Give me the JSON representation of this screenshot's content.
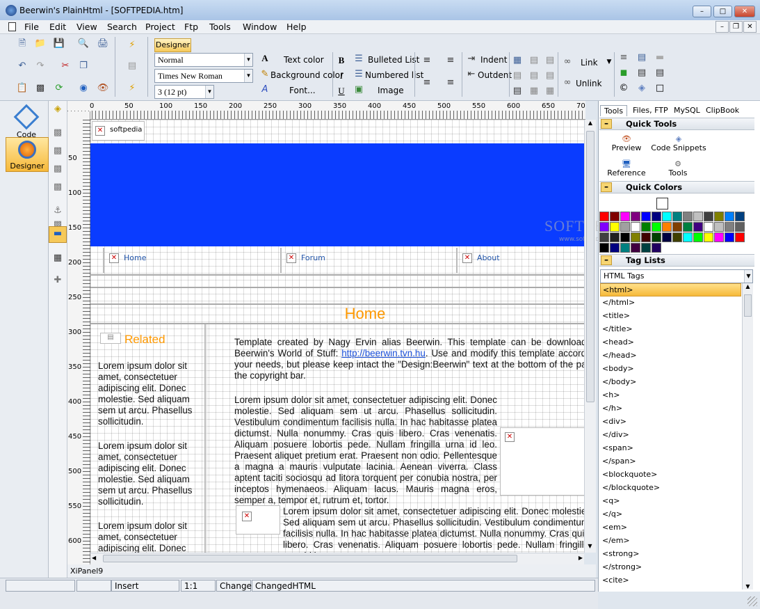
{
  "window": {
    "title": "Beerwin's PlainHtml - [SOFTPEDIA.htm]"
  },
  "menu": [
    "File",
    "Edit",
    "View",
    "Search",
    "Project",
    "Ftp",
    "Tools",
    "Window",
    "Help"
  ],
  "toolbar": {
    "designer_tab": "Designer",
    "paragraph_style": "Normal",
    "font_name": "Times New Roman",
    "font_size": "3  (12 pt)",
    "text_color": "Text color",
    "background_color": "Background color",
    "font": "Font...",
    "bulleted_list": "Bulleted List",
    "numbered_list": "Numbered list",
    "image": "Image",
    "indent": "Indent",
    "outdent": "Outdent",
    "link": "Link",
    "unlink": "Unlink"
  },
  "modes": {
    "code_editor": "Code Editor",
    "designer": "Designer"
  },
  "rulers": {
    "h": [
      "0",
      "50",
      "100",
      "150",
      "200",
      "250",
      "300",
      "350",
      "400",
      "450",
      "500",
      "550",
      "600",
      "650",
      "700"
    ],
    "v": [
      "50",
      "100",
      "150",
      "200",
      "250",
      "300",
      "350",
      "400",
      "450",
      "500",
      "550",
      "600"
    ]
  },
  "canvas": {
    "logo_alt": "softpedia",
    "nav": [
      "Home",
      "Forum",
      "About"
    ],
    "heading": "Home",
    "sidebar_title": "Related",
    "sidebar_text": "Lorem ipsum dolor sit amet, consectetuer adipiscing elit. Donec molestie. Sed aliquam sem ut arcu. Phasellus sollicitudin.",
    "sidebar_text_3": "Lorem ipsum dolor sit amet, consectetuer adipiscing elit. Donec",
    "p1_before": "Template created by Nagy Ervin alias Beerwin. This template can be downloaded at Beerwin's World of Stuff: ",
    "p1_link": "http://beerwin.tvn.hu",
    "p1_after": ". Use and modify this template according to your needs, but please keep intact the \"Design:Beerwin\" text at the bottom of the page, in the copyright bar.",
    "p2": "Lorem ipsum dolor sit amet, consectetuer adipiscing elit. Donec molestie. Sed aliquam sem ut arcu. Phasellus sollicitudin. Vestibulum condimentum facilisis nulla. In hac habitasse platea dictumst. Nulla nonummy. Cras quis libero. Cras venenatis. Aliquam posuere lobortis pede. Nullam fringilla urna id leo. Praesent aliquet pretium erat. Praesent non odio. Pellentesque a magna a mauris vulputate lacinia. Aenean viverra. Class aptent taciti sociosqu ad litora torquent per conubia nostra, per inceptos hymenaeos. Aliquam lacus. Mauris magna eros, semper a, tempor et, rutrum et, tortor.",
    "p3": "Lorem ipsum dolor sit amet, consectetuer adipiscing elit. Donec molestie. Sed aliquam sem ut arcu. Phasellus sollicitudin. Vestibulum condimentum facilisis nulla. In hac habitasse platea dictumst. Nulla nonummy. Cras quis libero. Cras venenatis. Aliquam posuere lobortis pede. Nullam fringilla urna id leo.",
    "header_color": "#0a3cff",
    "accent_color": "#ff9900"
  },
  "xipanel": "XiPanel9",
  "watermark": "SOFTPEDIA",
  "watermark_url": "www.softpedia.com",
  "right_panel": {
    "tabs": [
      "Tools",
      "Files, FTP",
      "MySQL",
      "ClipBook"
    ],
    "quick_tools_header": "Quick Tools",
    "quick_tools": [
      "Preview",
      "Code Snippets",
      "Reference",
      "Tools"
    ],
    "quick_colors_header": "Quick Colors",
    "tag_lists_header": "Tag Lists",
    "tag_list_selected": "HTML Tags",
    "tags": [
      "<html>",
      "</html>",
      "<title>",
      "</title>",
      "<head>",
      "</head>",
      "<body>",
      "</body>",
      "<h>",
      "</h>",
      "<div>",
      "</div>",
      "<span>",
      "</span>",
      "<blockquote>",
      "</blockquote>",
      "<q>",
      "</q>",
      "<em>",
      "</em>",
      "<strong>",
      "</strong>",
      "<cite>"
    ]
  },
  "palette_colors": [
    "#ff0000",
    "#800000",
    "#ff00ff",
    "#800080",
    "#0000ff",
    "#000080",
    "#00ffff",
    "#008080",
    "#808080",
    "#c0c0c0",
    "#404040",
    "#808000",
    "#0080ff",
    "#004080",
    "#8000ff",
    "#ffff00",
    "#a0a0a0",
    "#ffffff",
    "#008000",
    "#00ff00",
    "#ff8000",
    "#804000",
    "#008040",
    "#400080",
    "#ffffff",
    "#c0c0c0",
    "#808080",
    "#606060",
    "#404040",
    "#202020",
    "#000000",
    "#808000",
    "#400000",
    "#004000",
    "#000040",
    "#404000",
    "#00ffff",
    "#00ff00",
    "#ffff00",
    "#ff00ff",
    "#0000ff",
    "#ff0000",
    "#000000",
    "#000080",
    "#008080",
    "#400040",
    "#004040",
    "#200060"
  ],
  "status": {
    "mode": "Insert",
    "pos": "1:1",
    "change": "Change",
    "changed": "ChangedHTML"
  }
}
